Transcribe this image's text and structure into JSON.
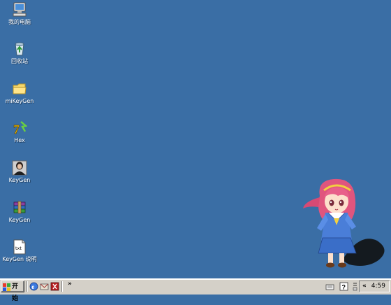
{
  "desktop": {
    "background_color": "#3a6ea5",
    "icons": [
      {
        "label": "我的电脑",
        "icon": "my-computer-icon"
      },
      {
        "label": "回收站",
        "icon": "recycle-bin-icon"
      },
      {
        "label": "miKeyGen",
        "icon": "folder-icon"
      },
      {
        "label": "Hex",
        "icon": "hex-editor-icon"
      },
      {
        "label": "KeyGen",
        "icon": "keygen-avatar-icon"
      },
      {
        "label": "KeyGen",
        "icon": "winrar-archive-icon"
      },
      {
        "label": "KeyGen 说明",
        "icon": "text-file-icon"
      }
    ],
    "wallpaper_character": "anime-girl-mascot"
  },
  "taskbar": {
    "start_label": "开始",
    "quick_launch": [
      "ie-icon",
      "outlook-icon",
      "mediaplayer-icon"
    ],
    "expand_label": "»",
    "tray_expand_label": "«",
    "clock": "4:59"
  }
}
